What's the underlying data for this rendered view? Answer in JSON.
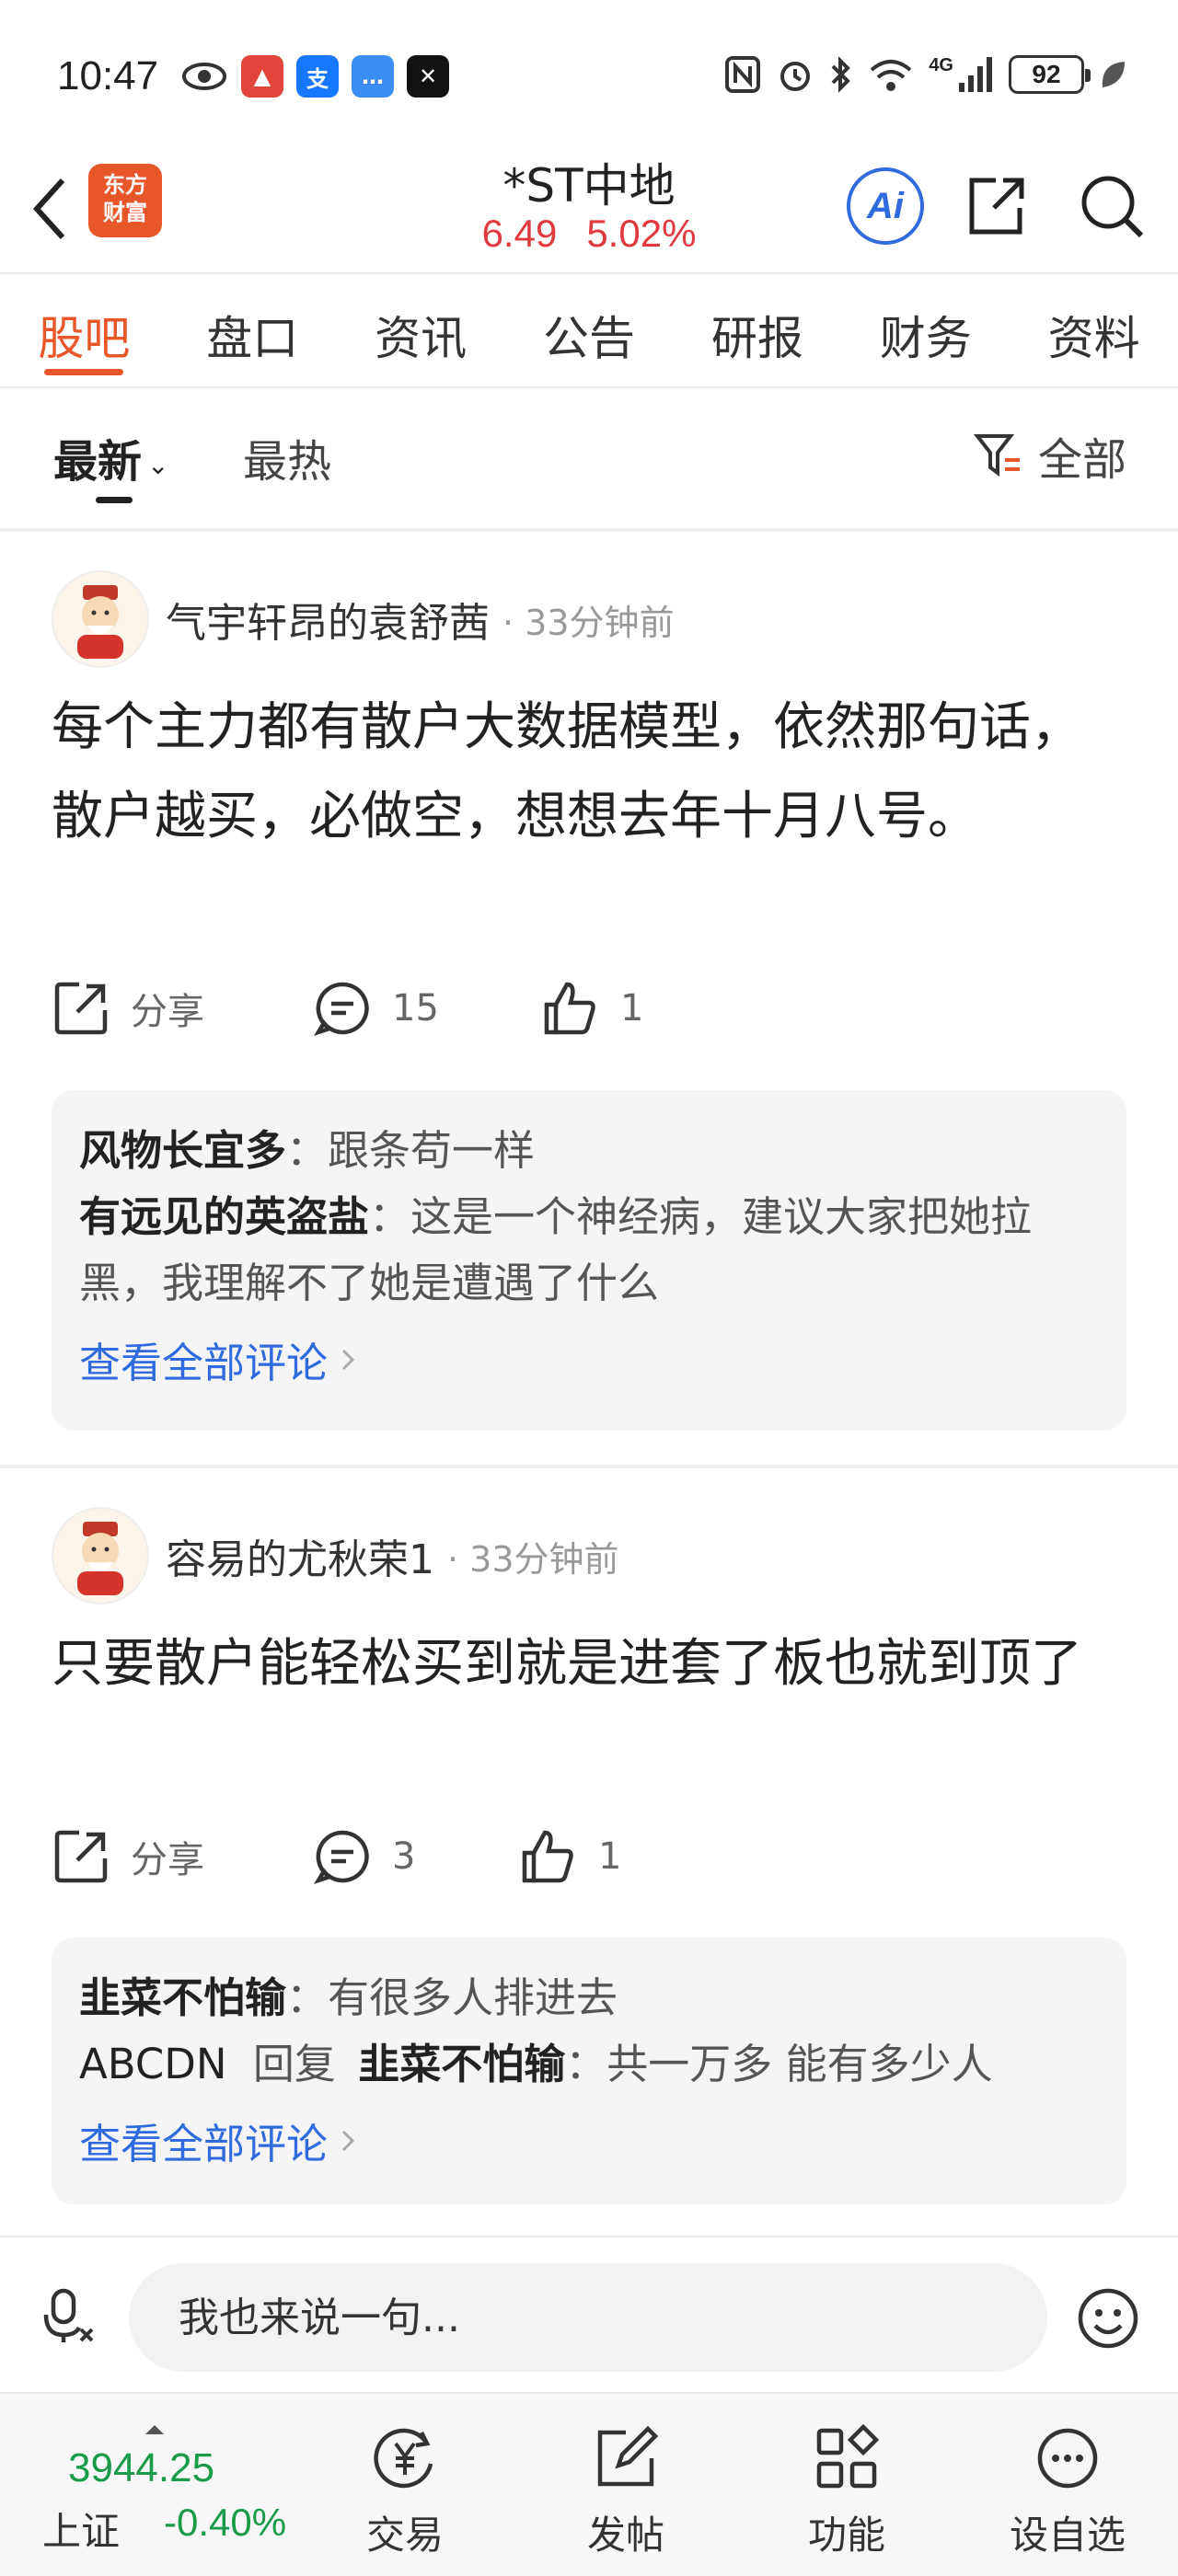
{
  "status_bar": {
    "time": "10:47",
    "battery": "92",
    "network": "4G"
  },
  "header": {
    "logo_text_line1": "东方",
    "logo_text_line2": "财富",
    "stock_name": "*ST中地",
    "price": "6.49",
    "change_pct": "5.02%",
    "ai_label": "Ai"
  },
  "tabs": [
    {
      "label": "股吧",
      "active": true
    },
    {
      "label": "盘口",
      "active": false
    },
    {
      "label": "资讯",
      "active": false
    },
    {
      "label": "公告",
      "active": false
    },
    {
      "label": "研报",
      "active": false
    },
    {
      "label": "财务",
      "active": false
    },
    {
      "label": "资料",
      "active": false
    }
  ],
  "sort": {
    "latest": "最新",
    "hottest": "最热",
    "filter": "全部"
  },
  "posts": [
    {
      "author": "气宇轩昂的袁舒茜",
      "time": "· 33分钟前",
      "body": "每个主力都有散户大数据模型，依然那句话，散户越买，必做空，想想去年十月八号。",
      "share": "分享",
      "comments": "15",
      "likes": "1",
      "replies": [
        {
          "author": "风物长宜多",
          "text": "：跟条苟一样"
        },
        {
          "author": "有远见的英盗盐",
          "text": "：这是一个神经病，建议大家把她拉黑，我理解不了她是遭遇了什么"
        }
      ],
      "view_all": "查看全部评论"
    },
    {
      "author": "容易的尤秋荣1",
      "time": "· 33分钟前",
      "body": "只要散户能轻松买到就是进套了板也就到顶了",
      "share": "分享",
      "comments": "3",
      "likes": "1",
      "replies": [
        {
          "author": "韭菜不怕输",
          "text": "：有很多人排进去"
        },
        {
          "author_plain": "ABCDN",
          "reply_word": "回复",
          "author": "韭菜不怕输",
          "text": "：共一万多 能有多少人"
        }
      ],
      "view_all": "查看全部评论"
    }
  ],
  "input_bar": {
    "placeholder": "我也来说一句..."
  },
  "bottom_nav": {
    "index_value": "3944.25",
    "index_name": "上证",
    "index_change": "-0.40%",
    "items": [
      {
        "label": "交易"
      },
      {
        "label": "发帖"
      },
      {
        "label": "功能"
      },
      {
        "label": "设自选"
      }
    ]
  },
  "colors": {
    "accent": "#e8572a",
    "price_up": "#e0393e",
    "index_down": "#1a9b4a",
    "link": "#2f6bde"
  }
}
